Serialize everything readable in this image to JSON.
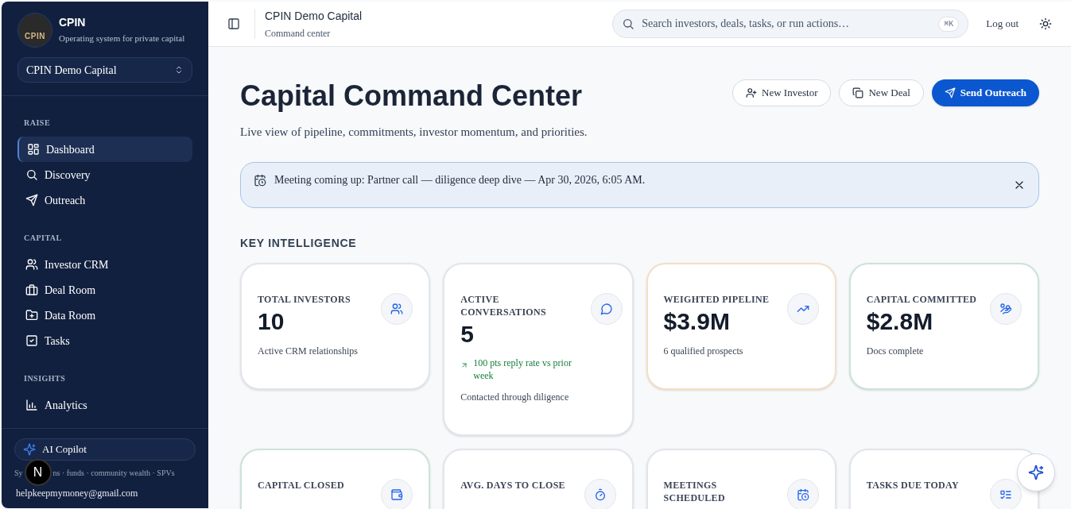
{
  "sidebar": {
    "brand": {
      "logo_text": "CPIN",
      "name": "CPIN",
      "tagline": "Operating system for private capital"
    },
    "workspace": "CPIN Demo Capital",
    "sections": [
      {
        "title": "RAISE",
        "items": [
          {
            "label": "Dashboard",
            "selected": true
          },
          {
            "label": "Discovery",
            "selected": false
          },
          {
            "label": "Outreach",
            "selected": false
          }
        ]
      },
      {
        "title": "CAPITAL",
        "items": [
          {
            "label": "Investor CRM",
            "selected": false
          },
          {
            "label": "Deal Room",
            "selected": false
          },
          {
            "label": "Data Room",
            "selected": false
          },
          {
            "label": "Tasks",
            "selected": false
          }
        ]
      },
      {
        "title": "INSIGHTS",
        "items": [
          {
            "label": "Analytics",
            "selected": false
          }
        ]
      }
    ],
    "copilot": "AI Copilot",
    "footer_parts": [
      "Sy",
      "ns · funds · community wealth · SPVs"
    ],
    "dev_badge": "N",
    "email": "helpkeepmymoney@gmail.com"
  },
  "header": {
    "title": "CPIN Demo Capital",
    "subtitle": "Command center",
    "search": {
      "placeholder": "Search investors, deals, tasks, or run actions…",
      "shortcut": "⌘K"
    },
    "logout": "Log out"
  },
  "page": {
    "title": "Capital Command Center",
    "subtitle": "Live view of pipeline, commitments, investor momentum, and priorities.",
    "actions": [
      {
        "label": "New Investor",
        "kind": "outline"
      },
      {
        "label": "New Deal",
        "kind": "outline"
      },
      {
        "label": "Send Outreach",
        "kind": "primary"
      }
    ]
  },
  "banner": {
    "text": "Meeting coming up: Partner call — diligence deep dive — Apr 30, 2026, 6:05 AM."
  },
  "section_title": "KEY INTELLIGENCE",
  "metrics": [
    {
      "label": "TOTAL INVESTORS",
      "value": "10",
      "note": "Active CRM relationships",
      "color": "#e2e5ea"
    },
    {
      "label": "ACTIVE CONVERSATIONS",
      "value": "5",
      "trend": "100 pts reply rate vs prior week",
      "note": "Contacted through diligence",
      "color": "#e2e5ea"
    },
    {
      "label": "WEIGHTED PIPELINE",
      "value": "$3.9M",
      "note": "6 qualified prospects",
      "color": "#f3dfc3"
    },
    {
      "label": "CAPITAL COMMITTED",
      "value": "$2.8M",
      "note": "Docs complete",
      "color": "#cde3d8"
    },
    {
      "label": "CAPITAL CLOSED",
      "color": "#cde3d8"
    },
    {
      "label": "AVG. DAYS TO CLOSE",
      "color": "#e2e5ea"
    },
    {
      "label": "MEETINGS SCHEDULED",
      "color": "#e2e5ea"
    },
    {
      "label": "TASKS DUE TODAY",
      "color": "#e2e5ea"
    }
  ]
}
